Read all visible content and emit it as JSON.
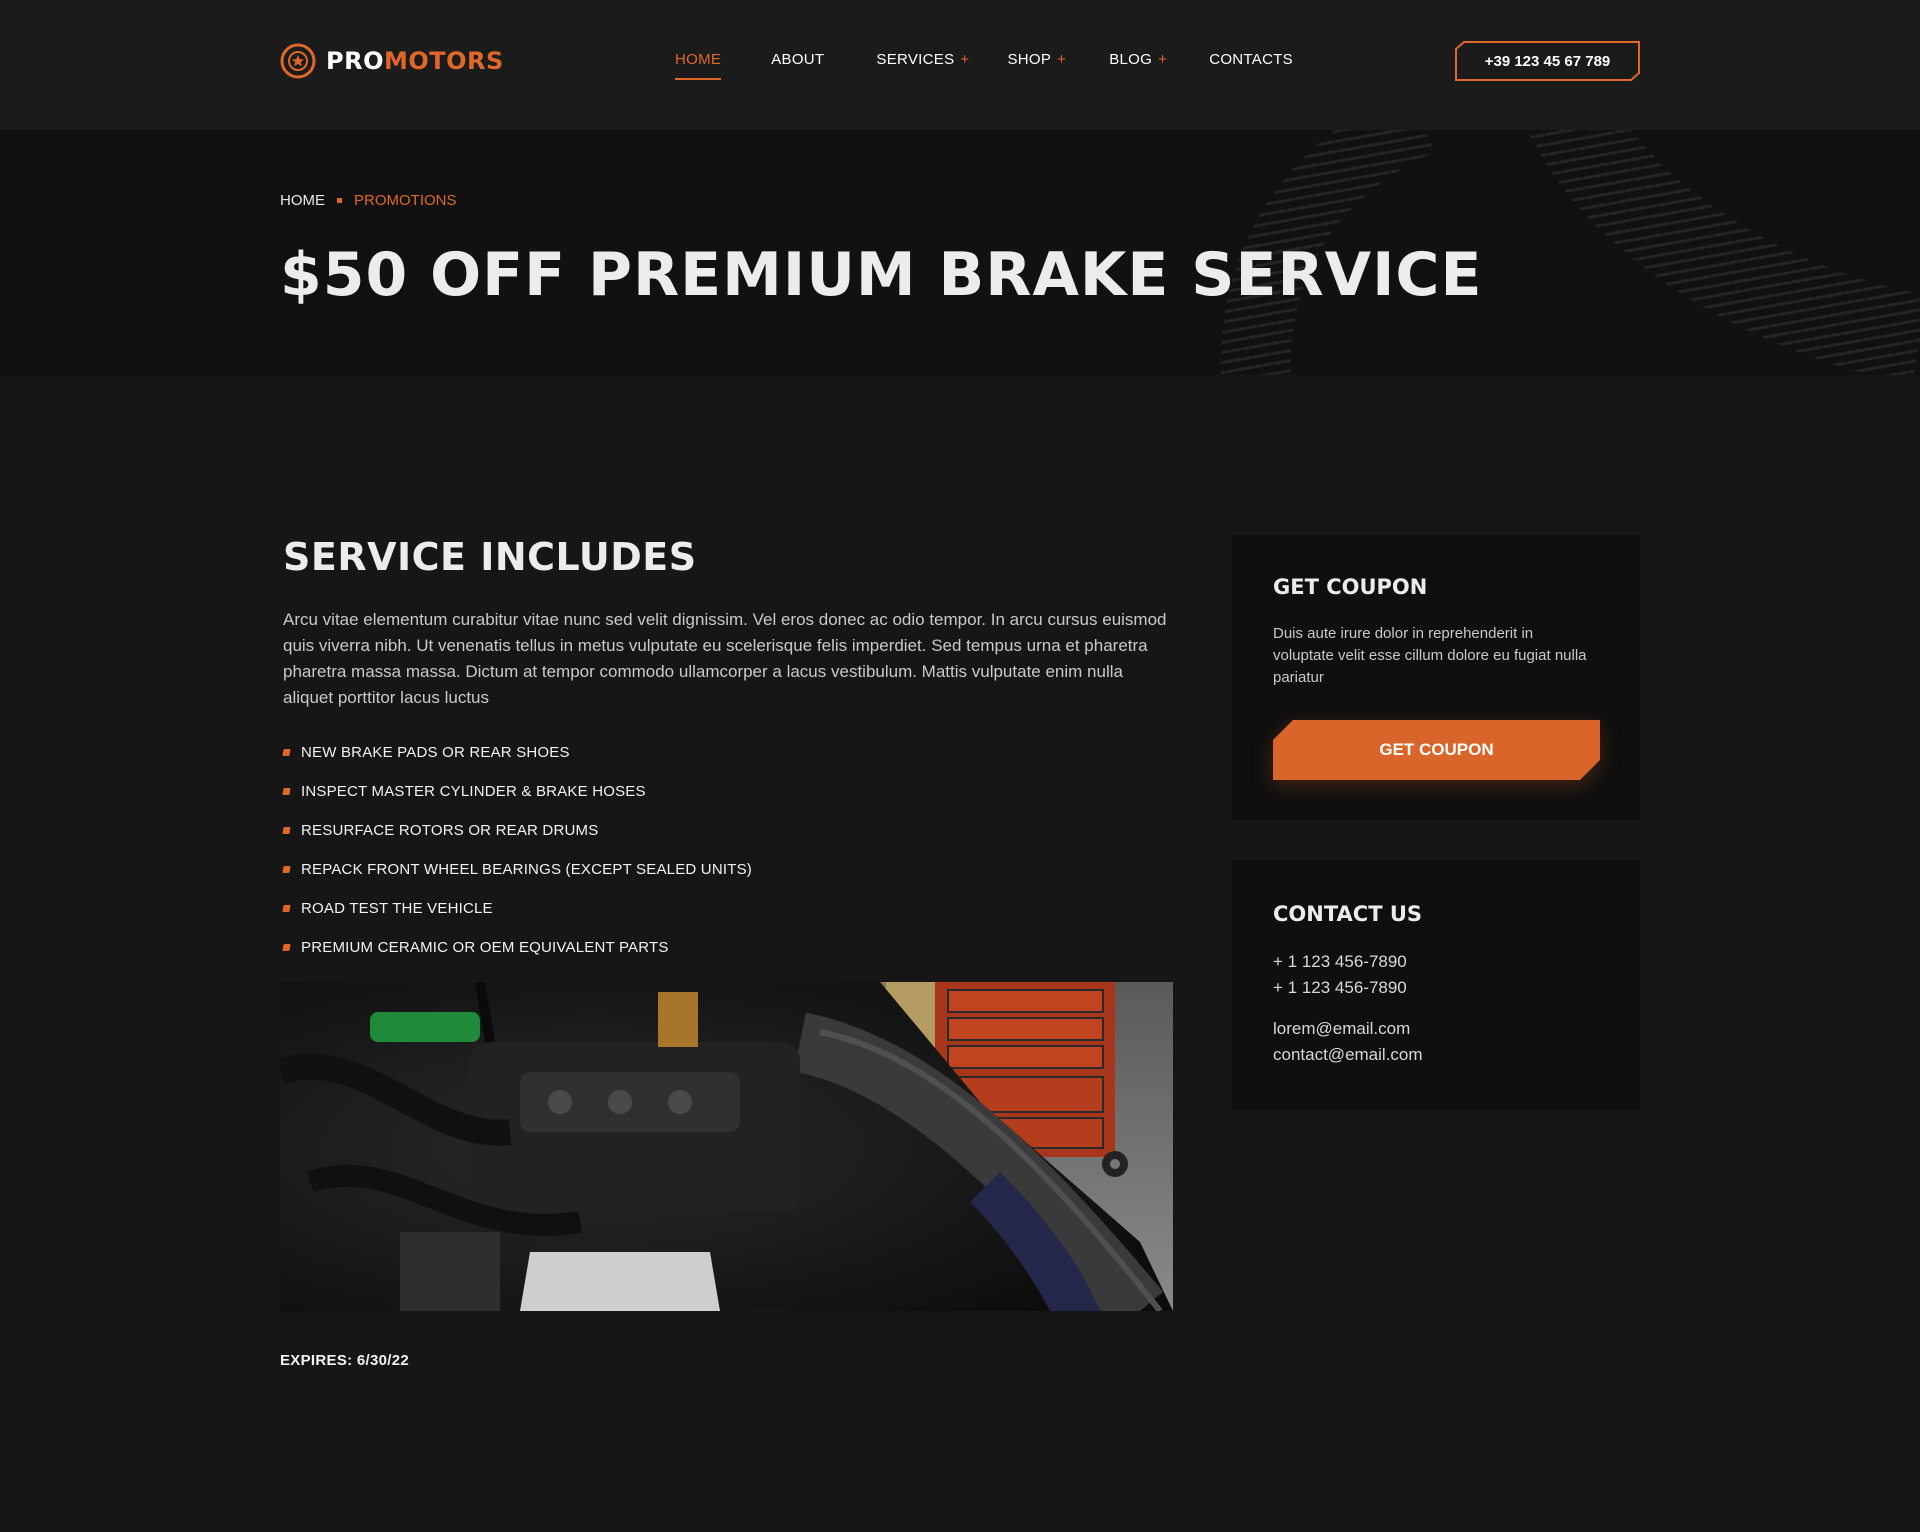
{
  "brand": {
    "pro": "PRO",
    "motors": "MOTORS",
    "accent": "#e0672a"
  },
  "nav": {
    "items": [
      {
        "label": "HOME",
        "active": true,
        "has_children": false
      },
      {
        "label": "ABOUT",
        "active": false,
        "has_children": false
      },
      {
        "label": "SERVICES",
        "active": false,
        "has_children": true
      },
      {
        "label": "SHOP",
        "active": false,
        "has_children": true
      },
      {
        "label": "BLOG",
        "active": false,
        "has_children": true
      },
      {
        "label": "CONTACTS",
        "active": false,
        "has_children": false
      }
    ],
    "submenu_indicator": "+"
  },
  "header": {
    "phone": "+39 123 45 67 789"
  },
  "hero": {
    "breadcrumb": {
      "home": "HOME",
      "current": "PROMOTIONS"
    },
    "title": "$50 OFF PREMIUM BRAKE SERVICE"
  },
  "main": {
    "section_title": "SERVICE INCLUDES",
    "intro": "Arcu vitae elementum curabitur vitae nunc sed velit dignissim. Vel eros donec ac odio tempor. In arcu cursus euismod quis viverra nibh. Ut venenatis tellus in metus vulputate eu scelerisque felis imperdiet. Sed tempus urna et pharetra pharetra massa massa. Dictum at tempor commodo ullamcorper a lacus vestibulum. Mattis vulputate enim nulla aliquet porttitor lacus luctus",
    "features": [
      "NEW BRAKE PADS OR REAR SHOES",
      "INSPECT MASTER CYLINDER & BRAKE HOSES",
      "RESURFACE ROTORS OR REAR DRUMS",
      "REPACK FRONT WHEEL BEARINGS (EXCEPT SEALED UNITS)",
      "ROAD TEST THE VEHICLE",
      "PREMIUM CERAMIC OR OEM EQUIVALENT PARTS"
    ],
    "expires": "EXPIRES: 6/30/22"
  },
  "sidebar": {
    "coupon": {
      "title": "GET COUPON",
      "text": "Duis aute irure dolor in reprehenderit in voluptate velit esse cillum dolore eu fugiat nulla pariatur",
      "button": "GET COUPON"
    },
    "contact": {
      "title": "CONTACT US",
      "phones": [
        "+ 1 123 456-7890",
        "+ 1 123 456-7890"
      ],
      "emails": [
        "lorem@email.com",
        "contact@email.com"
      ]
    }
  }
}
